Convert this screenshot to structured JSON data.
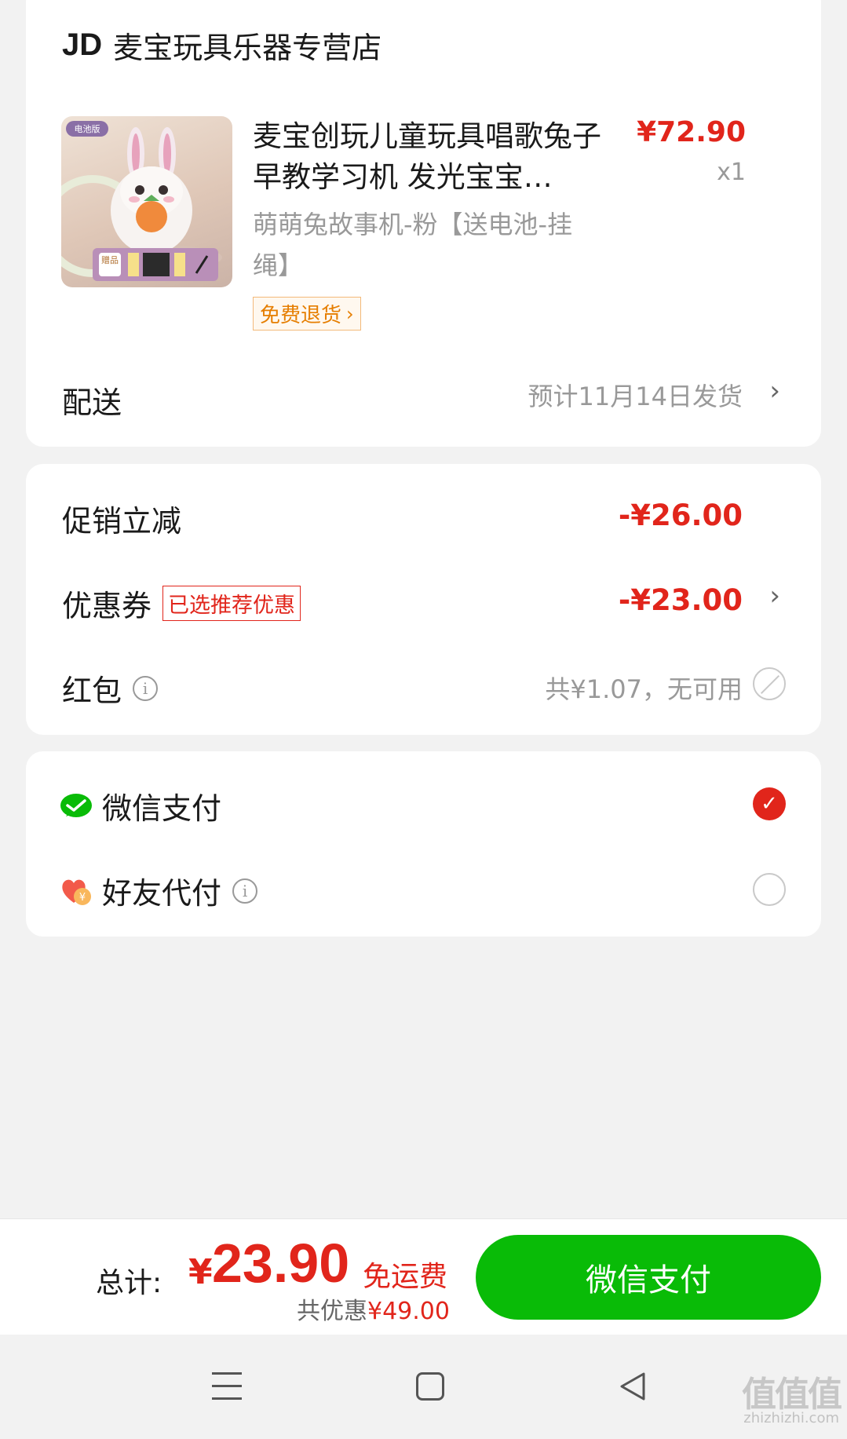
{
  "store": {
    "logo": "JD",
    "name": "麦宝玩具乐器专营店"
  },
  "product": {
    "title": "麦宝创玩儿童玩具唱歌兔子早教学习机 发光宝宝…",
    "price": "¥72.90",
    "qty": "x1",
    "spec": "萌萌兔故事机-粉【送电池-挂绳】",
    "return_tag": "免费退货",
    "image_badge": "电池版",
    "image_gift": "赠品"
  },
  "delivery": {
    "label": "配送",
    "value": "预计11月14日发货"
  },
  "discounts": {
    "promo_label": "促销立减",
    "promo_value": "-¥26.00",
    "coupon_label": "优惠券",
    "coupon_tag": "已选推荐优惠",
    "coupon_value": "-¥23.00",
    "redpack_label": "红包",
    "redpack_value": "共¥1.07，无可用"
  },
  "payment": {
    "wechat_label": "微信支付",
    "friend_label": "好友代付",
    "selected": "wechat"
  },
  "bottom": {
    "total_label": "总计:",
    "currency": "¥",
    "total": "23.90",
    "free_shipping": "免运费",
    "saved_prefix": "共优惠",
    "saved_amount": "¥49.00",
    "pay_button": "微信支付"
  },
  "watermark": {
    "text": "值值值",
    "sub": "zhizhizhi.com"
  },
  "colors": {
    "accent_red": "#e1251b",
    "wechat_green": "#09bb07"
  },
  "icons": [
    "info-icon",
    "chevron-right-icon",
    "disabled-icon",
    "wechat-icon",
    "heart-yuan-icon",
    "check-icon",
    "nav-menu-icon",
    "nav-home-icon",
    "nav-back-icon"
  ]
}
